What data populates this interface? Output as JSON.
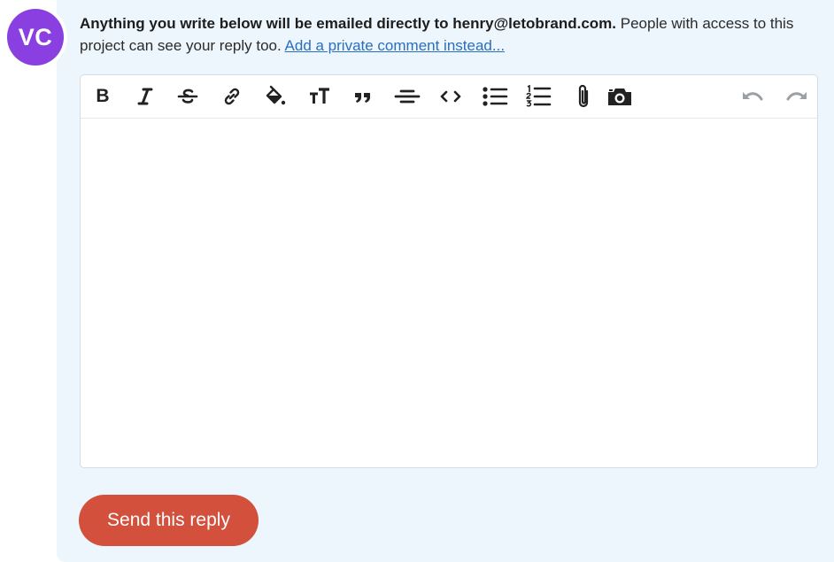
{
  "avatar": {
    "initials": "VC",
    "color": "#8a3fe0"
  },
  "notice": {
    "bold": "Anything you write below will be emailed directly to henry@letobrand.com.",
    "rest": " People with access to this project can see your reply too. ",
    "link": "Add a private comment instead..."
  },
  "toolbar": {
    "bold": "B",
    "icons": [
      "bold-icon",
      "italic-icon",
      "strikethrough-icon",
      "link-icon",
      "highlight-icon",
      "heading-icon",
      "quote-icon",
      "horizontal-rule-icon",
      "code-icon",
      "bullet-list-icon",
      "numbered-list-icon",
      "attachment-icon",
      "camera-icon",
      "undo-icon",
      "redo-icon"
    ]
  },
  "editor": {
    "value": ""
  },
  "actions": {
    "send_label": "Send this reply"
  },
  "colors": {
    "panel": "#ecf6fc",
    "send": "#d2503c",
    "link": "#2a6fbf",
    "icon": "#222222",
    "icon_disabled": "#9aa0a4"
  }
}
